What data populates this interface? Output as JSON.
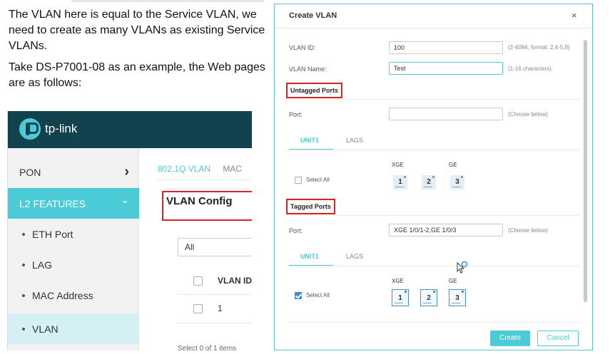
{
  "instructions": {
    "p1": "The VLAN here is equal to the Service VLAN, we need to create as many VLANs as existing Service VLANs.",
    "p2": "Take DS-P7001-08 as an example, the Web pages are as follows:"
  },
  "web": {
    "brand": "tp-link",
    "sidebar": {
      "items": [
        {
          "label": "PON",
          "chevron": "›"
        },
        {
          "label": "L2 FEATURES",
          "chevron": "⌄"
        },
        {
          "label": "ETH Port"
        },
        {
          "label": "LAG"
        },
        {
          "label": "MAC Address"
        },
        {
          "label": "VLAN"
        }
      ]
    },
    "content": {
      "tabs": [
        "802.1Q VLAN",
        "MAC"
      ],
      "title": "VLAN Config",
      "filter_value": "All",
      "column_header": "VLAN ID",
      "row_value": "1",
      "selection_info": "Select 0 of 1 items"
    }
  },
  "dialog": {
    "title": "Create VLAN",
    "close": "×",
    "vlan_id": {
      "label": "VLAN ID:",
      "value": "100",
      "hint": "(2-4094, format: 2,4-5,8)"
    },
    "vlan_name": {
      "label": "VLAN Name:",
      "value": "Test",
      "hint": "(1-16 characters)"
    },
    "untagged": {
      "section_label": "Untagged Ports",
      "port_label": "Port:",
      "port_value": "",
      "hint": "(Choose below)",
      "tabs": [
        "UNIT1",
        "LAGS"
      ],
      "groups": [
        "XGE",
        "GE"
      ],
      "select_all": "Select All",
      "select_all_checked": false,
      "ports": [
        "1",
        "2",
        "3"
      ]
    },
    "tagged": {
      "section_label": "Tagged Ports",
      "port_label": "Port:",
      "port_value": "XGE 1/0/1-2,GE 1/0/3",
      "hint": "(Choose below)",
      "tabs": [
        "UNIT1",
        "LAGS"
      ],
      "groups": [
        "XGE",
        "GE"
      ],
      "select_all": "Select All",
      "select_all_checked": true,
      "ports": [
        "1",
        "2",
        "3"
      ]
    },
    "buttons": {
      "create": "Create",
      "cancel": "Cancel"
    }
  },
  "colors": {
    "accent": "#4acbd6",
    "brand_bar": "#12424d",
    "highlight": "#e02020"
  }
}
